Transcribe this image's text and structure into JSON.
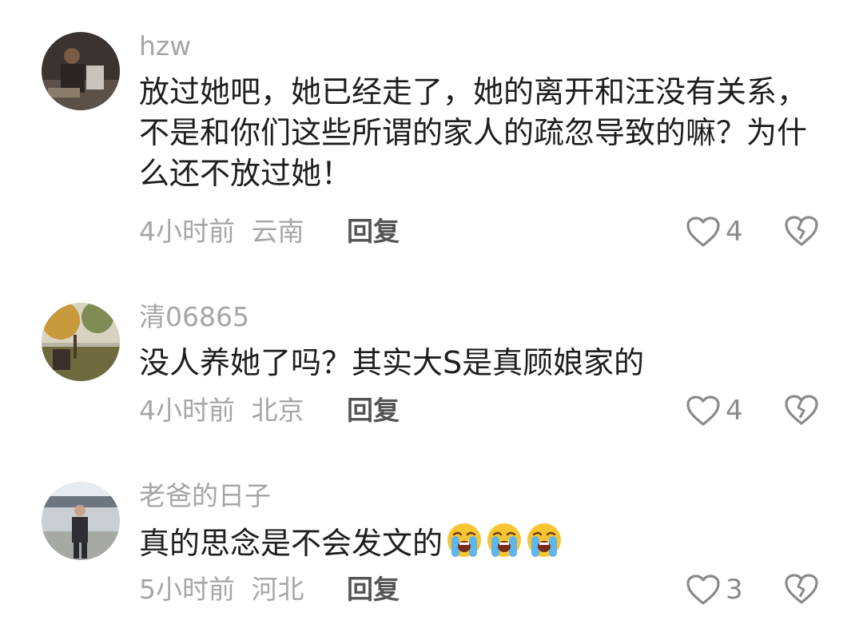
{
  "comments": [
    {
      "username": "hzw",
      "text": "放过她吧，她已经走了，她的离开和汪没有关系，不是和你们这些所谓的家人的疏忽导致的嘛？为什么还不放过她！",
      "time": "4小时前",
      "location": "云南",
      "reply_label": "回复",
      "likes": "4"
    },
    {
      "username": "清06865",
      "text": "没人养她了吗？其实大S是真顾娘家的",
      "time": "4小时前",
      "location": "北京",
      "reply_label": "回复",
      "likes": "4"
    },
    {
      "username": "老爸的日子",
      "text": "真的思念是不会发文的",
      "emoji_name": "loudly-crying-face-emoji",
      "emoji_count": 3,
      "time": "5小时前",
      "location": "河北",
      "reply_label": "回复",
      "likes": "3"
    }
  ],
  "colors": {
    "username": "#a6a6a6",
    "text": "#1e1e1e",
    "meta": "#a6a6a6",
    "reply": "#555555",
    "icon": "#8a8a8a"
  }
}
